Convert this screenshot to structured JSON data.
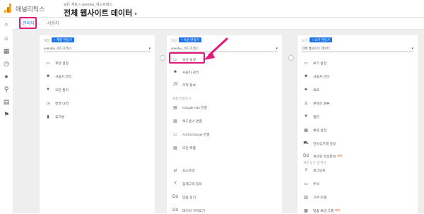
{
  "header": {
    "app_name": "애널리틱스",
    "breadcrumb": "모든 계정 > seenteu_워드프레스",
    "property": "전체 웹사이트 데이터"
  },
  "tabs": [
    {
      "label": "관리자"
    },
    {
      "label": "사용자"
    }
  ],
  "columns": {
    "account": {
      "heading": "계정",
      "create_label": "+ 계정 만들기",
      "selector": "seenteu_워드프레스",
      "items": [
        {
          "label": "계정 설정"
        },
        {
          "label": "사용자 관리"
        },
        {
          "label": "모든 필터"
        },
        {
          "label": "변경 내역"
        },
        {
          "label": "휴지통"
        }
      ]
    },
    "property": {
      "heading": "속성",
      "create_label": "+ 속성 만들기",
      "selector": "seenteu_워드프레스",
      "items": [
        {
          "label": "속성 설정"
        },
        {
          "label": "사용자 관리"
        },
        {
          "label": "추적 정보"
        }
      ],
      "links_heading": "제품 연결하기",
      "links": [
        {
          "label": "Google Ads 연결"
        },
        {
          "label": "애드센스 연결"
        },
        {
          "label": "Ad Exchange 연결"
        },
        {
          "label": "모든 제품"
        }
      ],
      "extra": [
        {
          "label": "포스트백"
        },
        {
          "label": "잠재고객 정의"
        },
        {
          "label": "맞춤 정의"
        },
        {
          "label": "데이터 가져오기"
        }
      ]
    },
    "view": {
      "heading": "보기",
      "create_label": "+ 보기 만들기",
      "selector": "전체 웹사이트 데이터",
      "items": [
        {
          "label": "보기 설정"
        },
        {
          "label": "사용자 관리"
        },
        {
          "label": "목표"
        },
        {
          "label": "콘텐츠 분류"
        },
        {
          "label": "필터"
        },
        {
          "label": "채널 설정"
        },
        {
          "label": "전자상거래 설정"
        },
        {
          "label": "계산된 측정항목"
        }
      ],
      "tools_heading": "개인 도구 및 자산",
      "tools": [
        {
          "label": "세그먼트"
        },
        {
          "label": "주석"
        },
        {
          "label": "기여 모델"
        },
        {
          "label": "맞춤 채널 그룹"
        }
      ],
      "new_badge": "베타"
    }
  },
  "colors": {
    "accent": "#1a73e8",
    "highlight": "#e2197a",
    "background": "#eeeeee"
  }
}
